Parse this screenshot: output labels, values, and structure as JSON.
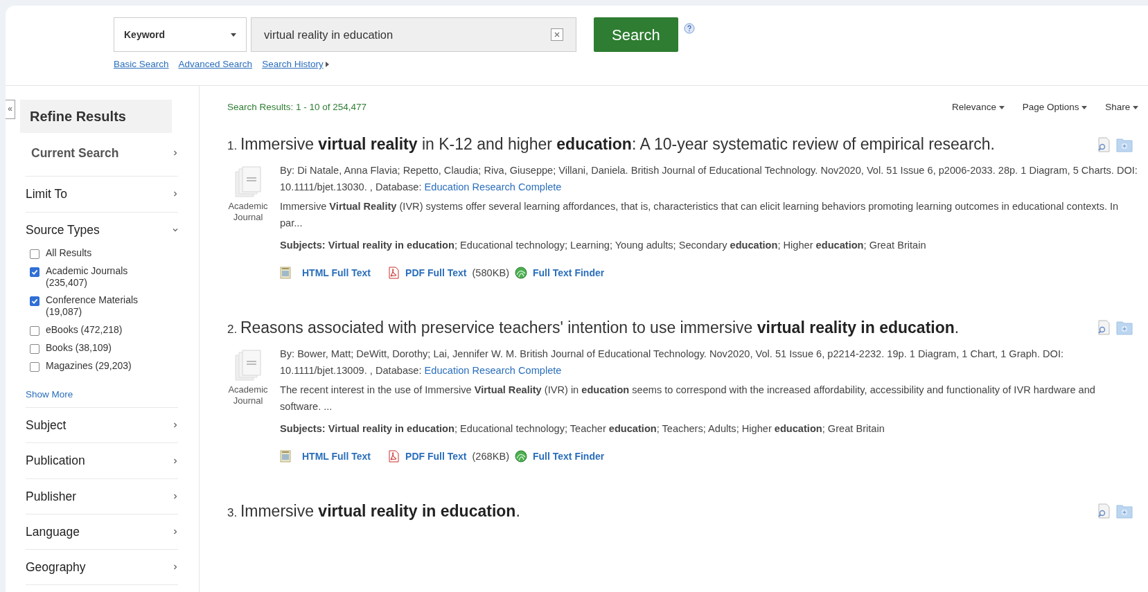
{
  "search_bar": {
    "field_type": "Keyword",
    "query": "virtual reality in education",
    "search_button": "Search",
    "links": [
      "Basic Search",
      "Advanced Search",
      "Search History"
    ]
  },
  "sidebar": {
    "collapse_button": "«",
    "title": "Refine Results",
    "facets": [
      {
        "label": "Current Search",
        "kind": "current",
        "expanded": false
      },
      {
        "label": "Limit To",
        "kind": "facet",
        "expanded": false
      },
      {
        "label": "Source Types",
        "kind": "facet",
        "expanded": true,
        "options": [
          {
            "label": "All Results",
            "checked": false
          },
          {
            "label": "Academic Journals (235,407)",
            "checked": true
          },
          {
            "label": "Conference Materials (19,087)",
            "checked": true
          },
          {
            "label": "eBooks (472,218)",
            "checked": false
          },
          {
            "label": "Books (38,109)",
            "checked": false
          },
          {
            "label": "Magazines (29,203)",
            "checked": false
          }
        ],
        "show_more": "Show More"
      },
      {
        "label": "Subject",
        "kind": "facet",
        "expanded": false
      },
      {
        "label": "Publication",
        "kind": "facet",
        "expanded": false
      },
      {
        "label": "Publisher",
        "kind": "facet",
        "expanded": false
      },
      {
        "label": "Language",
        "kind": "facet",
        "expanded": false
      },
      {
        "label": "Geography",
        "kind": "facet",
        "expanded": false
      }
    ]
  },
  "results_header": {
    "summary": "Search Results: 1 - 10 of 254,477",
    "menus": [
      "Relevance",
      "Page Options",
      "Share"
    ]
  },
  "results": [
    {
      "number": "1.",
      "title": "Immersive **virtual reality** in K-12 and higher **education**: A 10-year systematic review of empirical research.",
      "doc_type": "Academic Journal",
      "byline": "By: Di Natale, Anna Flavia; Repetto, Claudia; Riva, Giuseppe; Villani, Daniela. British Journal of Educational Technology. Nov2020, Vol. 51 Issue 6, p2006-2033. 28p. 1 Diagram, 5 Charts. DOI: 10.1111/bjet.13030. , Database: ",
      "database": "Education Research Complete",
      "abstract": "Immersive **Virtual Reality** (IVR) systems offer several learning affordances, that is, characteristics that can elicit learning behaviors promoting learning outcomes in educational contexts. In par...",
      "subjects": "**Subjects: Virtual reality in education**; Educational technology; Learning; Young adults; Secondary **education**; Higher **education**; Great Britain",
      "html_link": "HTML Full Text",
      "pdf_link": "PDF Full Text",
      "pdf_size": "(580KB)",
      "finder_link": "Full Text Finder"
    },
    {
      "number": "2.",
      "title": "Reasons associated with preservice teachers' intention to use immersive **virtual reality in education**.",
      "doc_type": "Academic Journal",
      "byline": "By: Bower, Matt; DeWitt, Dorothy; Lai, Jennifer W. M. British Journal of Educational Technology. Nov2020, Vol. 51 Issue 6, p2214-2232. 19p. 1 Diagram, 1 Chart, 1 Graph. DOI: 10.1111/bjet.13009. , Database: ",
      "database": "Education Research Complete",
      "abstract": "The recent interest in the use of Immersive **Virtual Reality** (IVR) in **education** seems to correspond with the increased affordability, accessibility and functionality of IVR hardware and software. ...",
      "subjects": "**Subjects: Virtual reality in education**; Educational technology; Teacher **education**; Teachers; Adults; Higher **education**; Great Britain",
      "html_link": "HTML Full Text",
      "pdf_link": "PDF Full Text",
      "pdf_size": "(268KB)",
      "finder_link": "Full Text Finder"
    },
    {
      "number": "3.",
      "title": "Immersive **virtual reality in education**."
    }
  ]
}
